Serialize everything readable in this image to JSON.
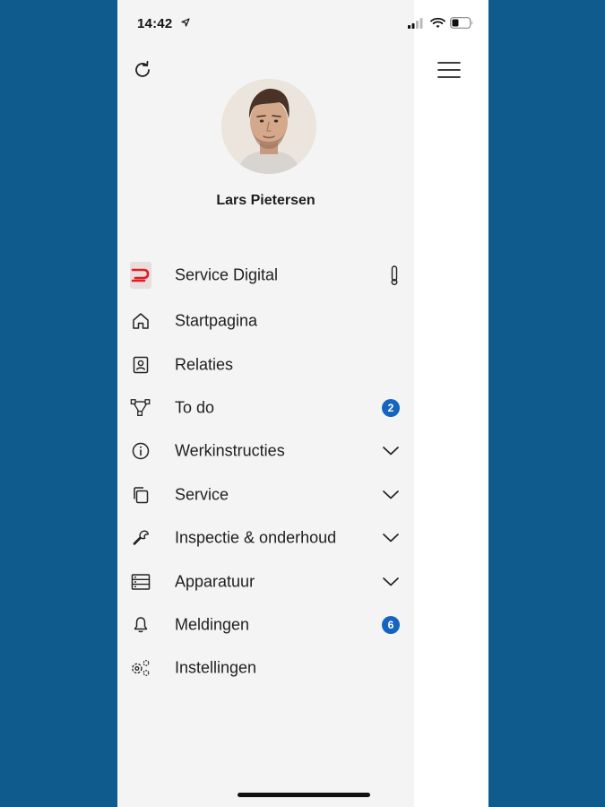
{
  "status_bar": {
    "time": "14:42"
  },
  "profile": {
    "name": "Lars Pietersen"
  },
  "menu": {
    "items": [
      {
        "label": "Service Digital"
      },
      {
        "label": "Startpagina"
      },
      {
        "label": "Relaties"
      },
      {
        "label": "To do",
        "badge": "2"
      },
      {
        "label": "Werkinstructies"
      },
      {
        "label": "Service"
      },
      {
        "label": "Inspectie & onderhoud"
      },
      {
        "label": "Apparatuur"
      },
      {
        "label": "Meldingen",
        "badge": "6"
      },
      {
        "label": "Instellingen"
      }
    ]
  },
  "colors": {
    "page_background": "#0f5b8e",
    "drawer_background": "#f4f4f4",
    "badge": "#1565c0",
    "brand_red": "#e31b23"
  },
  "icons": {
    "refresh": "refresh-icon",
    "menu": "hamburger-icon",
    "startpagina": "home-icon",
    "relaties": "contact-card-icon",
    "todo": "workflow-icon",
    "werkinstructies": "info-icon",
    "service": "copy-icon",
    "inspectie": "wrench-icon",
    "apparatuur": "list-box-icon",
    "meldingen": "bell-icon",
    "instellingen": "settings-icon"
  }
}
